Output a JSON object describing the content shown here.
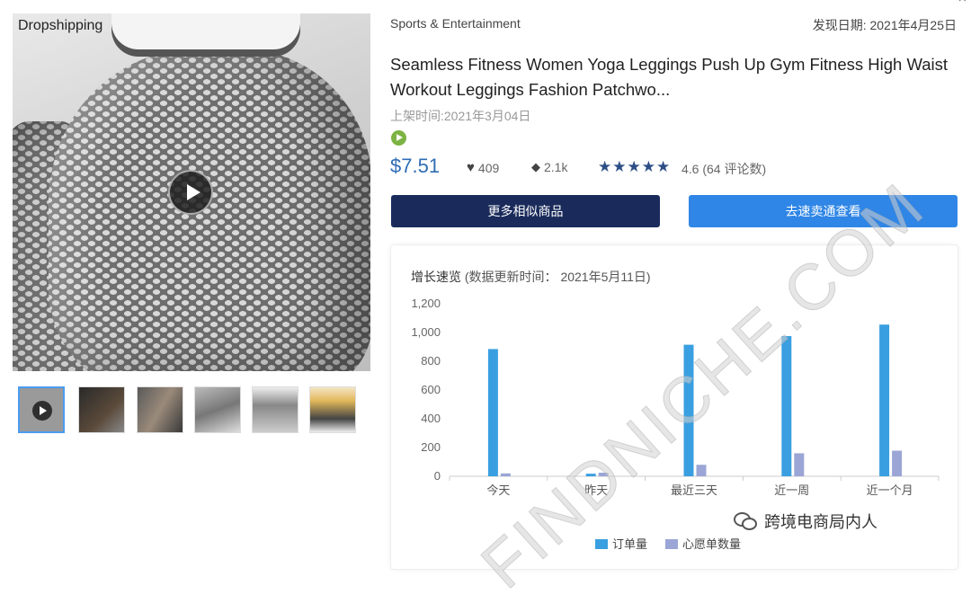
{
  "product": {
    "badge": "Dropshipping",
    "category": "Sports & Entertainment",
    "found_date": "发现日期: 2021年4月25日",
    "title": "Seamless Fitness Women Yoga Leggings Push Up Gym Fitness High Waist Workout Leggings Fashion Patchwo...",
    "listed_date": "上架时间:2021年3月04日",
    "price": "$7.51",
    "likes": "409",
    "tags": "2.1k",
    "rating_text": "4.6 (64 评论数)",
    "stars": "★★★★★",
    "rating_value": 4.6,
    "thumbnail_count": 6
  },
  "buttons": {
    "more_similar": "更多相似商品",
    "view_seller": "去速卖通查看"
  },
  "chart_card": {
    "title": "增长速览",
    "subtitle": "(数据更新时间：  2021年5月11日)"
  },
  "chart_data": {
    "type": "bar",
    "categories": [
      "今天",
      "昨天",
      "最近三天",
      "近一周",
      "近一个月"
    ],
    "series": [
      {
        "name": "订单量",
        "color": "#3a9fe0",
        "values": [
          885,
          18,
          915,
          975,
          1055
        ]
      },
      {
        "name": "心愿单数量",
        "color": "#9ba6d6",
        "values": [
          20,
          25,
          80,
          160,
          178
        ]
      }
    ],
    "yticks": [
      "0",
      "200",
      "400",
      "600",
      "800",
      "1,000",
      "1,200"
    ],
    "ylim": [
      0,
      1200
    ],
    "legend_position": "bottom",
    "grid": false
  },
  "watermark": "FINDNICHE.COM",
  "footer": {
    "wechat_label": "跨境电商局内人"
  },
  "colors": {
    "price": "#2f6db5",
    "button_dark": "#1a2b5b",
    "button_blue": "#2f86e6",
    "stars": "#2d4f86"
  }
}
